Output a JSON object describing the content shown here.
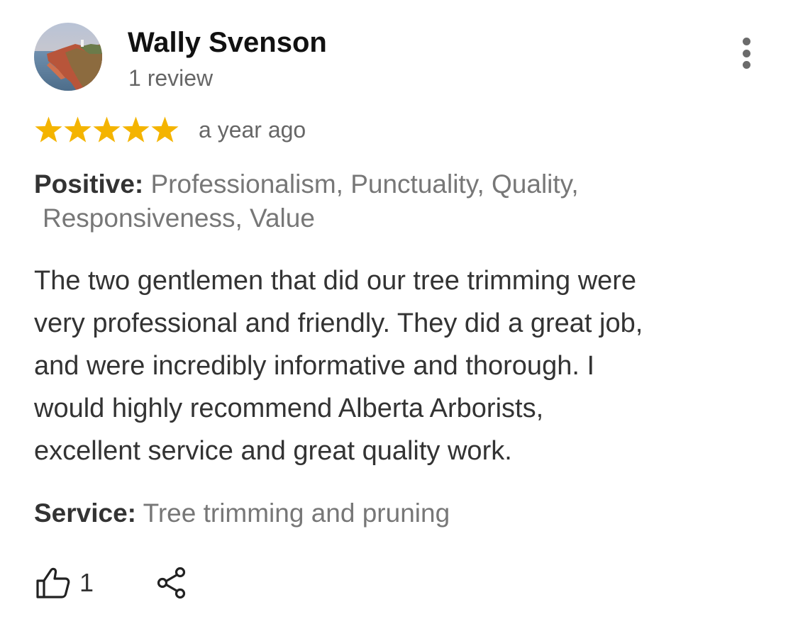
{
  "reviewer": {
    "name": "Wally Svenson",
    "review_count": "1 review",
    "avatar_icon": "coastal-landscape-photo"
  },
  "menu": {
    "icon": "more-vertical-icon"
  },
  "rating": {
    "stars": 5,
    "max_stars": 5,
    "star_color": "#f4b400",
    "date": "a year ago"
  },
  "attributes": {
    "positive_label": "Positive:",
    "positive_line1": " Professionalism, Punctuality, Quality,",
    "positive_line2": "Responsiveness, Value"
  },
  "review": {
    "lines": [
      "The two gentlemen that did our tree trimming were",
      "very professional and friendly. They did a great job,",
      "and were incredibly informative and thorough.  I",
      "would highly recommend Alberta Arborists,",
      "excellent service and great quality work."
    ]
  },
  "service": {
    "label": "Service:",
    "value": " Tree trimming and pruning"
  },
  "actions": {
    "like_icon": "thumbs-up-icon",
    "like_count": "1",
    "share_icon": "share-icon"
  },
  "colors": {
    "text_primary": "#111111",
    "text_secondary": "#666666",
    "star": "#f4b400"
  }
}
